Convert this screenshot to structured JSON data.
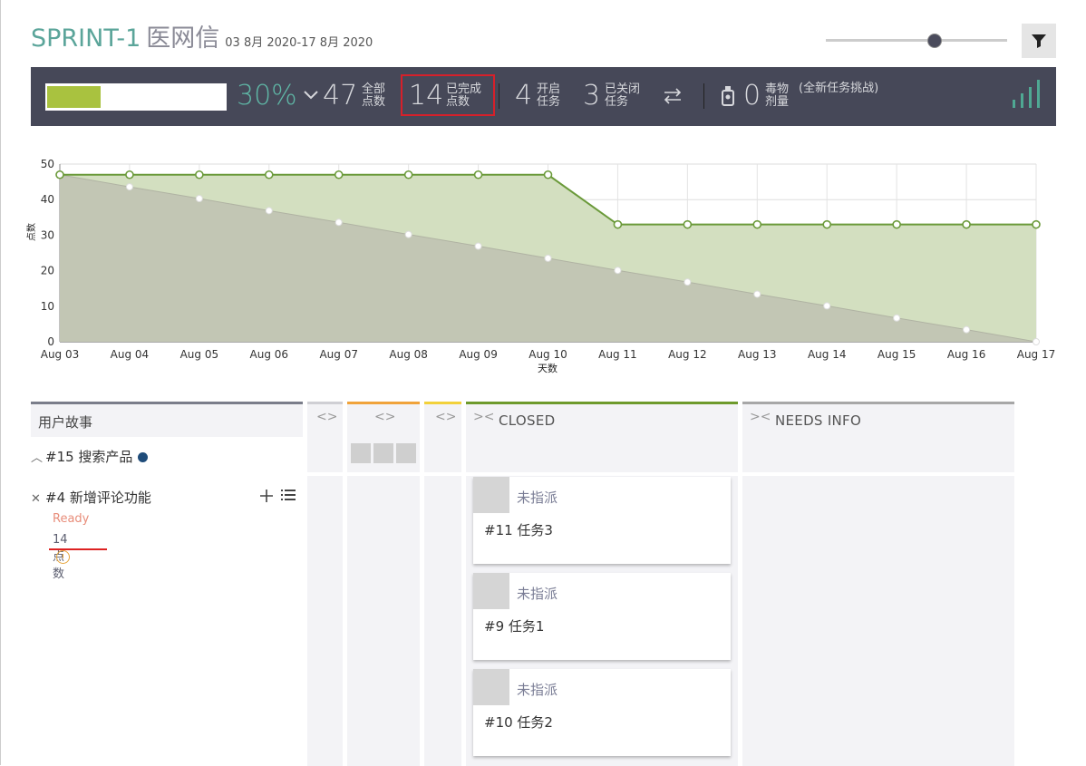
{
  "header": {
    "sprint": "SPRINT-1",
    "project": "医网信",
    "dates": "03 8月 2020-17 8月 2020"
  },
  "zoom_level": 0.6,
  "stats": {
    "progress_fraction": 0.3,
    "percent": "30%",
    "total_points": "47",
    "total_label": [
      "全部",
      "点数"
    ],
    "completed_points": "14",
    "completed_label": [
      "已完成",
      "点数"
    ],
    "open_tasks": "4",
    "open_label": [
      "开启",
      "任务"
    ],
    "closed_tasks": "3",
    "closed_label": [
      "已关闭",
      "任务"
    ],
    "iocaine": "0",
    "iocaine_label": [
      "毒物",
      "剂量"
    ],
    "challenge": "(全新任务挑战)"
  },
  "chart_data": {
    "type": "area",
    "x": [
      "Aug 03",
      "Aug 04",
      "Aug 05",
      "Aug 06",
      "Aug 07",
      "Aug 08",
      "Aug 09",
      "Aug 10",
      "Aug 11",
      "Aug 12",
      "Aug 13",
      "Aug 14",
      "Aug 15",
      "Aug 16",
      "Aug 17"
    ],
    "series": [
      {
        "values": [
          47,
          47,
          47,
          47,
          47,
          47,
          47,
          47,
          33,
          33,
          33,
          33,
          33,
          33,
          33
        ]
      },
      {
        "values": [
          47,
          43.6,
          40.3,
          36.9,
          33.6,
          30.2,
          26.9,
          23.5,
          20.1,
          16.8,
          13.4,
          10.1,
          6.7,
          3.4,
          0
        ]
      }
    ],
    "xlabel": "天数",
    "ylabel": "点数",
    "ylim": [
      0,
      50
    ],
    "yticks": [
      0,
      10,
      20,
      30,
      40,
      50
    ],
    "grid": true,
    "colors": {
      "actual": "#6b9a3a",
      "actual_fill": "#d3dfc0",
      "ideal_fill": "#c2c6b4"
    }
  },
  "board": {
    "stories_header": "用户故事",
    "stories": [
      {
        "title": "#15 搜索产品"
      },
      {
        "title": "#4 新增评论功能",
        "status": "Ready",
        "points": "14点数"
      }
    ],
    "columns": [
      {
        "color": "#cfcfd4"
      },
      {
        "color": "#f0a33a"
      },
      {
        "color": "#f2d13a"
      },
      {
        "name": "CLOSED",
        "color": "#6e9a2c"
      },
      {
        "name": "NEEDS INFO",
        "color": "#a7a7a7"
      }
    ],
    "cards": [
      {
        "assignee": "未指派",
        "title": "#11 任务3"
      },
      {
        "assignee": "未指派",
        "title": "#9 任务1"
      },
      {
        "assignee": "未指派",
        "title": "#10 任务2"
      }
    ]
  }
}
